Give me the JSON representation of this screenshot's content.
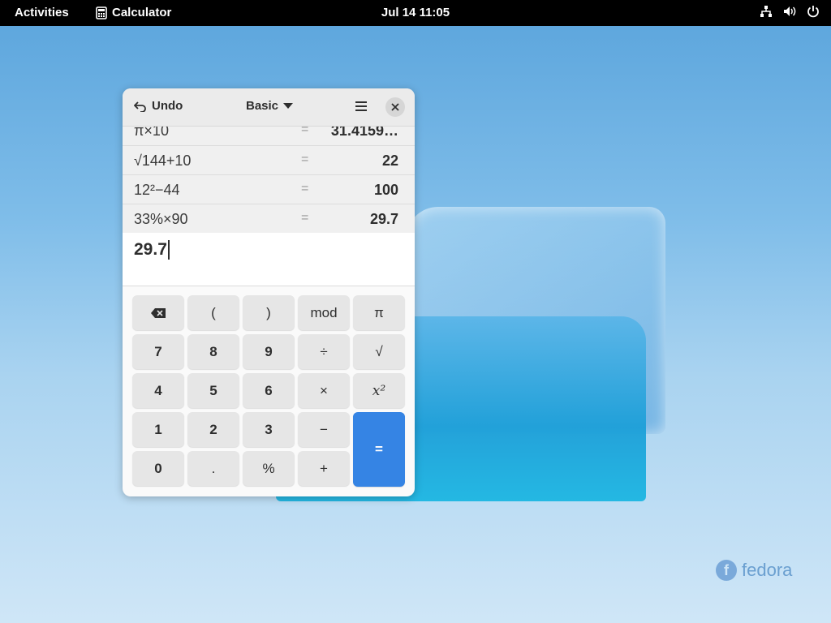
{
  "topbar": {
    "activities": "Activities",
    "app_name": "Calculator",
    "clock": "Jul 14  11:05"
  },
  "wallpaper": {
    "logo_text": "fedora",
    "logo_letter": "f"
  },
  "calculator": {
    "undo_label": "Undo",
    "mode_label": "Basic",
    "history": [
      {
        "expr": "π×10",
        "eq": "=",
        "result": "31.4159…"
      },
      {
        "expr": "√144+10",
        "eq": "=",
        "result": "22"
      },
      {
        "expr": "12²−44",
        "eq": "=",
        "result": "100"
      },
      {
        "expr": "33%×90",
        "eq": "=",
        "result": "29.7"
      }
    ],
    "entry_value": "29.7",
    "keys": {
      "backspace": "",
      "open_paren": "(",
      "close_paren": ")",
      "mod": "mod",
      "pi": "π",
      "seven": "7",
      "eight": "8",
      "nine": "9",
      "divide": "÷",
      "sqrt": "√",
      "four": "4",
      "five": "5",
      "six": "6",
      "multiply": "×",
      "square": "x²",
      "one": "1",
      "two": "2",
      "three": "3",
      "minus": "−",
      "zero": "0",
      "point": ".",
      "percent": "%",
      "plus": "+",
      "equals": "="
    }
  },
  "colors": {
    "accent": "#3584e4",
    "topbar": "#000000"
  }
}
